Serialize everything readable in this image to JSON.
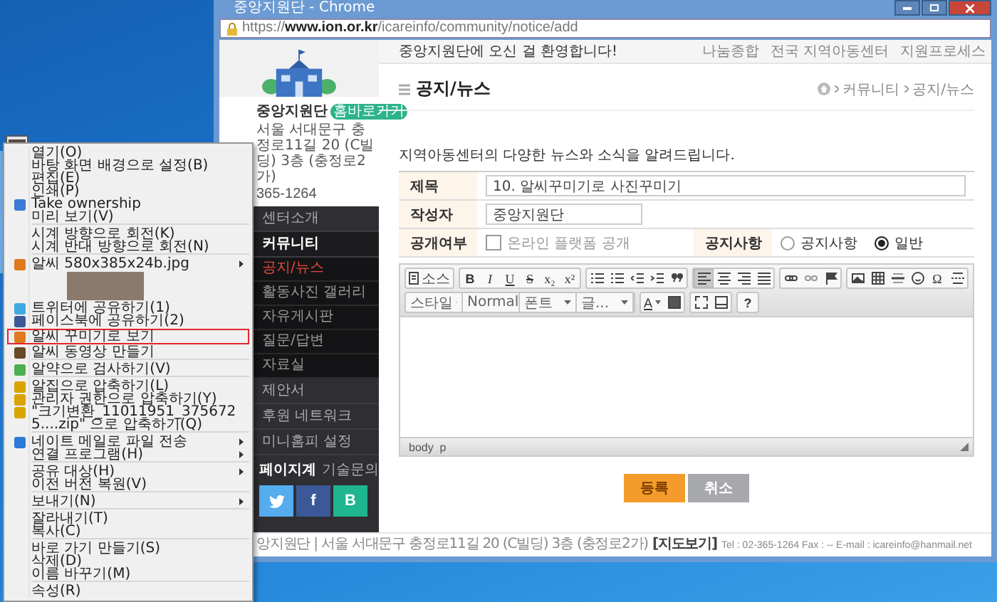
{
  "browser": {
    "title": "중앙지원단 - Chrome",
    "url_scheme": "https://",
    "url_host": "www.ion.or.kr",
    "url_path": "/icareinfo/community/notice/add"
  },
  "topbar": {
    "welcome": "중앙지원단에 오신 걸 환영합니다!",
    "links": [
      "나눔종합",
      "전국 지역아동센터",
      "지원프로세스"
    ]
  },
  "sidebar": {
    "org_name": "중앙지원단",
    "badge": "홈바로가기",
    "address": "서울 서대문구 충정로11길 20 (C빌딩) 3층 (충정로2가)",
    "phone": "365-1264",
    "menu": [
      {
        "label": "센터소개",
        "selected": false
      },
      {
        "label": "커뮤니티",
        "selected": true,
        "children": [
          {
            "label": "공지/뉴스",
            "selected": true
          },
          {
            "label": "활동사진 갤러리",
            "selected": false
          },
          {
            "label": "자유게시판",
            "selected": false
          },
          {
            "label": "질문/답변",
            "selected": false
          },
          {
            "label": "자료실",
            "selected": false
          }
        ]
      },
      {
        "label": "제안서",
        "selected": false
      },
      {
        "label": "후원 네트워크",
        "selected": false
      },
      {
        "label": "미니홈피 설정",
        "selected": false
      }
    ],
    "contact_lead": "페이지계",
    "contact_link": "기술문의",
    "social": [
      {
        "kind": "twitter"
      },
      {
        "kind": "facebook",
        "label": "f"
      },
      {
        "kind": "blog",
        "label": "B"
      }
    ]
  },
  "page": {
    "title": "공지/뉴스",
    "breadcrumb": [
      "커뮤니티",
      "공지/뉴스"
    ],
    "intro": "지역아동센터의 다양한 뉴스와 소식을 알려드립니다."
  },
  "form": {
    "title_label": "제목",
    "title_value": "10. 알씨꾸미기로 사진꾸미기",
    "author_label": "작성자",
    "author_value": "중앙지원단",
    "public_label": "공개여부",
    "public_checkbox": {
      "label": "온라인 플랫폼 공개",
      "checked": false
    },
    "notice_label": "공지사항",
    "notice_options": [
      {
        "label": "공지사항",
        "selected": false
      },
      {
        "label": "일반",
        "selected": true
      }
    ]
  },
  "editor": {
    "toolbar_rows": [
      [
        [
          {
            "kind": "source",
            "label": "소스",
            "selected": false
          }
        ],
        [
          {
            "kind": "bold",
            "label": "B",
            "selected": false
          },
          {
            "kind": "italic",
            "label": "I",
            "selected": false
          },
          {
            "kind": "underline",
            "label": "U",
            "selected": false
          },
          {
            "kind": "strike",
            "label": "S",
            "selected": false
          },
          {
            "kind": "glyph",
            "label": "x₂",
            "selected": false
          },
          {
            "kind": "glyph",
            "label": "x²",
            "selected": false
          }
        ],
        [
          {
            "kind": "numbered",
            "selected": false
          },
          {
            "kind": "bulleted",
            "selected": false
          },
          {
            "kind": "outdent",
            "selected": false
          },
          {
            "kind": "indent",
            "selected": false
          },
          {
            "kind": "quote",
            "selected": false
          }
        ],
        [
          {
            "kind": "alignleft",
            "selected": true
          },
          {
            "kind": "aligncenter",
            "selected": false
          },
          {
            "kind": "alignright",
            "selected": false
          },
          {
            "kind": "justify",
            "selected": false
          }
        ],
        [
          {
            "kind": "link",
            "selected": false
          },
          {
            "kind": "unlink",
            "selected": false
          },
          {
            "kind": "flag",
            "selected": false
          }
        ],
        [
          {
            "kind": "image",
            "selected": false
          },
          {
            "kind": "table",
            "selected": false
          },
          {
            "kind": "rule",
            "selected": false
          },
          {
            "kind": "smiley",
            "selected": false
          },
          {
            "kind": "glyph",
            "label": "Ω",
            "selected": false
          },
          {
            "kind": "pagebreak",
            "selected": false
          }
        ]
      ],
      [
        [
          {
            "kind": "dropdown",
            "label": "스타일"
          },
          {
            "kind": "dropdown",
            "label": "Normal"
          },
          {
            "kind": "dropdown",
            "label": "폰트"
          },
          {
            "kind": "dropdown",
            "label": "글..."
          }
        ],
        [
          {
            "kind": "textcolor",
            "label": "A",
            "selected": false
          },
          {
            "kind": "fillcolor",
            "selected": false
          }
        ],
        [
          {
            "kind": "maximize",
            "selected": false
          },
          {
            "kind": "blocks",
            "selected": false
          }
        ],
        [
          {
            "kind": "bold",
            "label": "?",
            "selected": false
          }
        ]
      ]
    ],
    "status": "body  p"
  },
  "buttons": [
    {
      "label": "등록",
      "kind": "primary"
    },
    {
      "label": "취소",
      "kind": "secondary"
    }
  ],
  "footer": {
    "text": "앙지원단 | 서울 서대문구 충정로11길 20 (C빌딩) 3층 (충정로2가)",
    "link": "[지도보기]",
    "contact": "Tel : 02-365-1264 Fax : -- E-mail : icareinfo@hanmail.net"
  },
  "context_menu": [
    {
      "kind": "plain",
      "label": "열기(O)",
      "submenu": false,
      "marked": false
    },
    {
      "kind": "plain",
      "label": "바탕 화면 배경으로 설정(B)",
      "submenu": false,
      "marked": false
    },
    {
      "kind": "plain",
      "label": "편집(E)",
      "submenu": false,
      "marked": false
    },
    {
      "kind": "plain",
      "label": "인쇄(P)",
      "submenu": false,
      "marked": false
    },
    {
      "kind": "shield",
      "label": "Take ownership",
      "submenu": false,
      "marked": false
    },
    {
      "kind": "plain",
      "label": "미리 보기(V)",
      "submenu": false,
      "marked": false
    },
    {
      "kind": "separator"
    },
    {
      "kind": "plain",
      "label": "시계 방향으로 회전(K)",
      "submenu": false,
      "marked": false
    },
    {
      "kind": "plain",
      "label": "시계 반대 방향으로 회전(N)",
      "submenu": false,
      "marked": false
    },
    {
      "kind": "separator"
    },
    {
      "kind": "alsee",
      "label": "알씨 580x385x24b.jpg",
      "submenu": true,
      "marked": false
    },
    {
      "kind": "image"
    },
    {
      "kind": "twitter",
      "label": "트위터에 공유하기(1)",
      "submenu": false,
      "marked": false
    },
    {
      "kind": "facebook",
      "label": "페이스북에 공유하기(2)",
      "submenu": false,
      "marked": false
    },
    {
      "kind": "alsee",
      "label": "알씨 꾸미기로 보기",
      "submenu": false,
      "marked": true
    },
    {
      "kind": "film",
      "label": "알씨 동영상 만들기",
      "submenu": false,
      "marked": false
    },
    {
      "kind": "separator"
    },
    {
      "kind": "pill",
      "label": "알약으로 검사하기(V)",
      "submenu": false,
      "marked": false
    },
    {
      "kind": "separator"
    },
    {
      "kind": "zip",
      "label": "알집으로 압축하기(L)",
      "submenu": false,
      "marked": false
    },
    {
      "kind": "zip",
      "label": "관리자 권한으로 압축하기(Y)",
      "submenu": false,
      "marked": false
    },
    {
      "kind": "zip",
      "label": "\"크기변환_11011951_3756725....zip\" 으로 압축하기(Q)",
      "submenu": false,
      "marked": false
    },
    {
      "kind": "separator"
    },
    {
      "kind": "mail",
      "label": "네이트 메일로 파일 전송",
      "submenu": true,
      "marked": false
    },
    {
      "kind": "plain",
      "label": "연결 프로그램(H)",
      "submenu": true,
      "marked": false
    },
    {
      "kind": "separator"
    },
    {
      "kind": "plain",
      "label": "공유 대상(H)",
      "submenu": true,
      "marked": false
    },
    {
      "kind": "plain",
      "label": "이전 버전 복원(V)",
      "submenu": false,
      "marked": false
    },
    {
      "kind": "separator"
    },
    {
      "kind": "plain",
      "label": "보내기(N)",
      "submenu": true,
      "marked": false
    },
    {
      "kind": "separator"
    },
    {
      "kind": "plain",
      "label": "잘라내기(T)",
      "submenu": false,
      "marked": false
    },
    {
      "kind": "plain",
      "label": "복사(C)",
      "submenu": false,
      "marked": false
    },
    {
      "kind": "separator"
    },
    {
      "kind": "plain",
      "label": "바로 가기 만들기(S)",
      "submenu": false,
      "marked": false
    },
    {
      "kind": "plain",
      "label": "삭제(D)",
      "submenu": false,
      "marked": false
    },
    {
      "kind": "plain",
      "label": "이름 바꾸기(M)",
      "submenu": false,
      "marked": false
    },
    {
      "kind": "separator"
    },
    {
      "kind": "plain",
      "label": "속성(R)",
      "submenu": false,
      "marked": false
    }
  ]
}
